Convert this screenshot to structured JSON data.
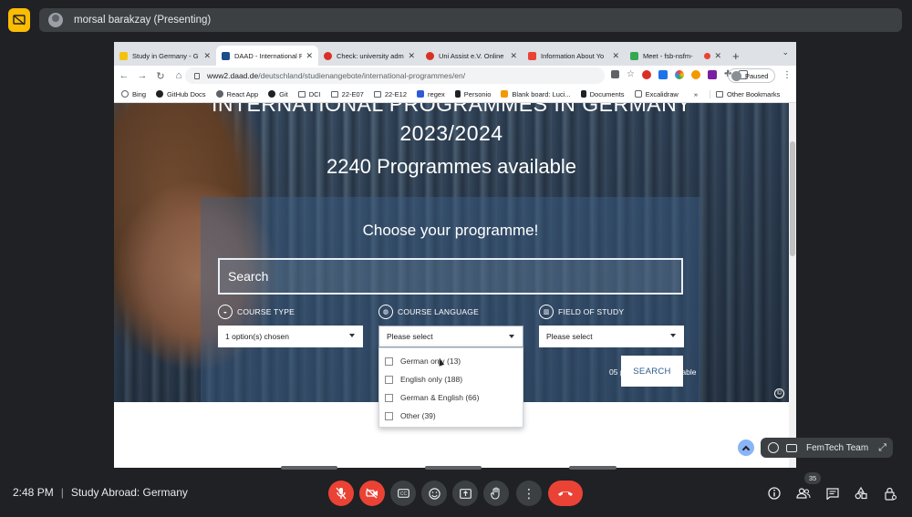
{
  "meet": {
    "presenter": "morsal barakzay (Presenting)",
    "time": "2:48 PM",
    "meeting_title": "Study Abroad: Germany",
    "tile_name": "FemTech Team",
    "participant_count": "35",
    "colors": {
      "accent_yellow": "#fbbc04",
      "danger_red": "#ea4335",
      "panel": "#3c4043",
      "bg": "#202124"
    }
  },
  "browser": {
    "tabs": [
      {
        "title": "Study in Germany - G",
        "favicon_color": "#f4c20d"
      },
      {
        "title": "DAAD - International P",
        "favicon_color": "#1a4e8a",
        "active": true
      },
      {
        "title": "Check: university adm",
        "favicon_color": "#d93025"
      },
      {
        "title": "Uni Assist e.V. Online",
        "favicon_color": "#d93025"
      },
      {
        "title": "Information About Yo",
        "favicon_color": "#ea4335"
      },
      {
        "title": "Meet - fsb-nsfm-",
        "favicon_color": "#34a853"
      }
    ],
    "url_host": "www2.daad.de",
    "url_path": "/deutschland/studienangebote/international-programmes/en/",
    "profile_status": "Paused",
    "bookmarks": [
      {
        "label": "Bing",
        "icon": "search-icon"
      },
      {
        "label": "GitHub Docs",
        "icon": "github-icon"
      },
      {
        "label": "React App",
        "icon": "globe-icon"
      },
      {
        "label": "Git",
        "icon": "github-icon"
      },
      {
        "label": "DCI",
        "icon": "folder-icon"
      },
      {
        "label": "22-E07",
        "icon": "folder-icon"
      },
      {
        "label": "22-E12",
        "icon": "folder-icon"
      },
      {
        "label": "regex",
        "icon": "r-icon"
      },
      {
        "label": "Personio",
        "icon": "personio-icon"
      },
      {
        "label": "Blank board: Luci...",
        "icon": "lucid-icon"
      },
      {
        "label": "Documents",
        "icon": "docs-icon"
      },
      {
        "label": "Excalidraw",
        "icon": "excalidraw-icon"
      }
    ],
    "bookmarks_overflow": "»",
    "other_bookmarks": "Other Bookmarks"
  },
  "daad": {
    "title_line1": "INTERNATIONAL PROGRAMMES IN GERMANY",
    "title_line2": "2023/2024",
    "programmes_available": "2240 Programmes available",
    "choose_heading": "Choose your programme!",
    "search_placeholder": "Search",
    "filters": {
      "course_type": {
        "label": "COURSE TYPE",
        "value": "1 option(s) chosen"
      },
      "course_language": {
        "label": "COURSE LANGUAGE",
        "value": "Please select"
      },
      "field_of_study": {
        "label": "FIELD OF STUDY",
        "value": "Please select"
      }
    },
    "language_options": [
      {
        "label": "German only (13)"
      },
      {
        "label": "English only (188)"
      },
      {
        "label": "German & English (66)"
      },
      {
        "label": "Other (39)"
      }
    ],
    "results_text": "05 programmes available",
    "search_button": "SEARCH",
    "copyright": "©"
  }
}
